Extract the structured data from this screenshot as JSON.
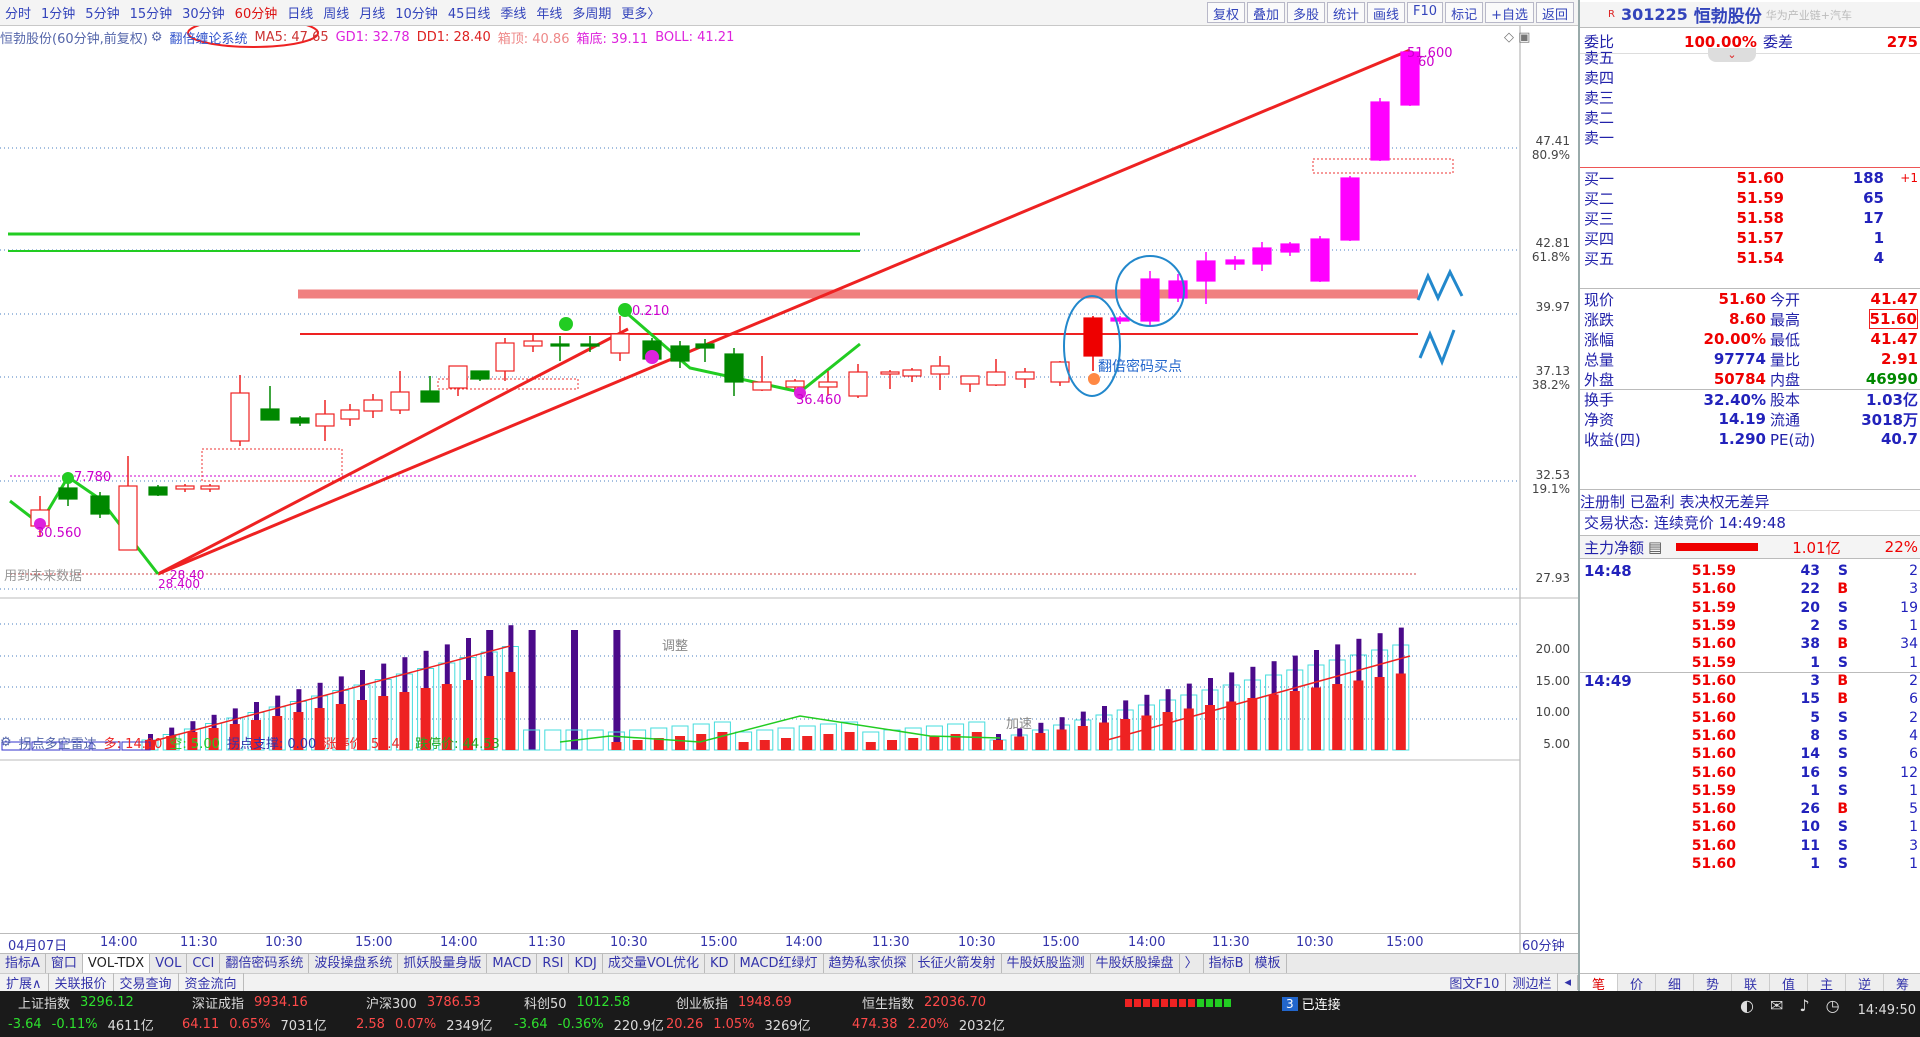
{
  "periods": [
    "分时",
    "1分钟",
    "5分钟",
    "15分钟",
    "30分钟",
    "60分钟",
    "日线",
    "周线",
    "月线",
    "10分钟",
    "45日线",
    "季线",
    "年线",
    "多周期",
    "更多〉"
  ],
  "active_period": "60分钟",
  "toolbar_right": [
    "复权",
    "叠加",
    "多股",
    "统计",
    "画线",
    "F10",
    "标记",
    "+自选",
    "返回"
  ],
  "info": {
    "stock": "恒勃股份(60分钟,前复权)",
    "system": "翻倍缠论系统",
    "ma5": "MA5: 47.65",
    "gd1": "GD1: 32.78",
    "dd1": "DD1: 28.40",
    "xd": "箱顶: 40.86",
    "xb": "箱底: 39.11",
    "boll": "BOLL: 41.21"
  },
  "ylabels": [
    {
      "v": "47.41",
      "pct": "80.9%"
    },
    {
      "v": "42.81",
      "pct": "61.8%"
    },
    {
      "v": "39.97",
      "pct": ""
    },
    {
      "v": "37.13",
      "pct": "38.2%"
    },
    {
      "v": "32.53",
      "pct": "19.1%"
    },
    {
      "v": "27.93",
      "pct": ""
    }
  ],
  "annotations": {
    "high": "51.600",
    "high2": "60",
    "p1": "0.210",
    "p2": "36.460",
    "p3": "30.560",
    "p4": "7.780",
    "p5": "28.40",
    "p6": "28.400",
    "buy": "翻倍密码买点",
    "future": "用到未来数据",
    "tiaozheng": "调整",
    "jiashu": "加速"
  },
  "indicator": {
    "name": "拐点多空雷达",
    "duo": "多: 14.00",
    "kong": "空: 5.00",
    "zhicheng": "拐点支撑: 0.00",
    "zt": "涨停价: 54.43",
    "dt": "跌停价: 44.53"
  },
  "ind_ylabels": [
    "20.00",
    "15.00",
    "10.00",
    "5.00"
  ],
  "xlabels": [
    "04月07日",
    "14:00",
    "11:30",
    "10:30",
    "15:00",
    "14:00",
    "11:30",
    "10:30",
    "15:00",
    "14:00",
    "11:30",
    "10:30",
    "15:00",
    "14:00",
    "11:30",
    "10:30",
    "15:00"
  ],
  "x_unit": "60分钟",
  "tabs": [
    "指标A",
    "窗口",
    "VOL-TDX",
    "VOL",
    "CCI",
    "翻倍密码系统",
    "波段操盘系统",
    "抓妖股量身版",
    "MACD",
    "RSI",
    "KDJ",
    "成交量VOL优化",
    "KD",
    "MACD红绿灯",
    "趋势私家侦探",
    "长征火箭发射",
    "牛股妖股监测",
    "牛股妖股操盘",
    "〉",
    "指标B",
    "模板"
  ],
  "tabs2": [
    "扩展∧",
    "关联报价",
    "交易查询",
    "资金流向"
  ],
  "tabs2_right": [
    "图文F10",
    "测边栏",
    "◂"
  ],
  "status": {
    "indices": [
      {
        "name": "上证指数",
        "val": "3296.12",
        "chg": "-3.64",
        "pct": "-0.11%",
        "amt": "4611亿",
        "up": false
      },
      {
        "name": "深证成指",
        "val": "9934.16",
        "chg": "64.11",
        "pct": "0.65%",
        "amt": "7031亿",
        "up": true
      },
      {
        "name": "沪深300",
        "val": "3786.53",
        "chg": "2.58",
        "pct": "0.07%",
        "amt": "2349亿",
        "up": true
      },
      {
        "name": "科创50",
        "val": "1012.58",
        "chg": "-3.64",
        "pct": "-0.36%",
        "amt": "220.9亿",
        "up": false
      },
      {
        "name": "创业板指",
        "val": "1948.69",
        "chg": "20.26",
        "pct": "1.05%",
        "amt": "3269亿",
        "up": true
      },
      {
        "name": "恒生指数",
        "val": "22036.70",
        "chg": "474.38",
        "pct": "2.20%",
        "amt": "2032亿",
        "up": true
      }
    ],
    "connect": "已连接",
    "connect_num": "3",
    "time": "14:49:50"
  },
  "side": {
    "code": "301225",
    "name": "恒勃股份",
    "tag": "华为产业链+汽车",
    "wb_label": "委比",
    "wb": "100.00%",
    "wc_label": "委差",
    "wc": "275",
    "sells": [
      "卖五",
      "卖四",
      "卖三",
      "卖二",
      "卖一"
    ],
    "buys": [
      {
        "l": "买一",
        "p": "51.60",
        "v": "188",
        "d": "+1"
      },
      {
        "l": "买二",
        "p": "51.59",
        "v": "65",
        "d": ""
      },
      {
        "l": "买三",
        "p": "51.58",
        "v": "17",
        "d": ""
      },
      {
        "l": "买四",
        "p": "51.57",
        "v": "1",
        "d": ""
      },
      {
        "l": "买五",
        "p": "51.54",
        "v": "4",
        "d": ""
      }
    ],
    "quote": [
      {
        "l": "现价",
        "v": "51.60",
        "l2": "今开",
        "v2": "41.47",
        "c": "red",
        "c2": "red"
      },
      {
        "l": "涨跌",
        "v": "8.60",
        "l2": "最高",
        "v2": "51.60",
        "c": "red",
        "c2": "red"
      },
      {
        "l": "涨幅",
        "v": "20.00%",
        "l2": "最低",
        "v2": "41.47",
        "c": "red",
        "c2": "red"
      },
      {
        "l": "总量",
        "v": "97774",
        "l2": "量比",
        "v2": "2.91",
        "c": "blue",
        "c2": "red"
      },
      {
        "l": "外盘",
        "v": "50784",
        "l2": "内盘",
        "v2": "46990",
        "c": "red",
        "c2": "grn"
      },
      {
        "l": "换手",
        "v": "32.40%",
        "l2": "股本",
        "v2": "1.03亿",
        "c": "blue",
        "c2": "blue"
      },
      {
        "l": "净资",
        "v": "14.19",
        "l2": "流通",
        "v2": "3018万",
        "c": "blue",
        "c2": "blue"
      },
      {
        "l": "收益(四)",
        "v": "1.290",
        "l2": "PE(动)",
        "v2": "40.7",
        "c": "blue",
        "c2": "blue"
      }
    ],
    "reg": "注册制 已盈利 表决权无差异",
    "trade_state": "交易状态: 连续竞价 14:49:48",
    "zl_label": "主力净额",
    "zl": "1.01亿",
    "zl_pct": "22%",
    "ticks1_time": "14:48",
    "ticks1": [
      [
        "51.59",
        "43",
        "S",
        "2"
      ],
      [
        "51.60",
        "22",
        "B",
        "3"
      ],
      [
        "51.59",
        "20",
        "S",
        "19"
      ],
      [
        "51.59",
        "2",
        "S",
        "1"
      ],
      [
        "51.60",
        "38",
        "B",
        "34"
      ],
      [
        "51.59",
        "1",
        "S",
        "1"
      ]
    ],
    "ticks2_time": "14:49",
    "ticks2": [
      [
        "51.60",
        "3",
        "B",
        "2"
      ],
      [
        "51.60",
        "15",
        "B",
        "6"
      ],
      [
        "51.60",
        "5",
        "S",
        "2"
      ],
      [
        "51.60",
        "8",
        "S",
        "4"
      ],
      [
        "51.60",
        "14",
        "S",
        "6"
      ],
      [
        "51.60",
        "16",
        "S",
        "12"
      ],
      [
        "51.59",
        "1",
        "S",
        "1"
      ],
      [
        "51.60",
        "26",
        "B",
        "5"
      ],
      [
        "51.60",
        "10",
        "S",
        "1"
      ],
      [
        "51.60",
        "11",
        "S",
        "3"
      ],
      [
        "51.60",
        "1",
        "S",
        "1"
      ]
    ],
    "tabs": [
      "笔",
      "价",
      "细",
      "势",
      "联",
      "值",
      "主",
      "逆",
      "筹"
    ]
  }
}
